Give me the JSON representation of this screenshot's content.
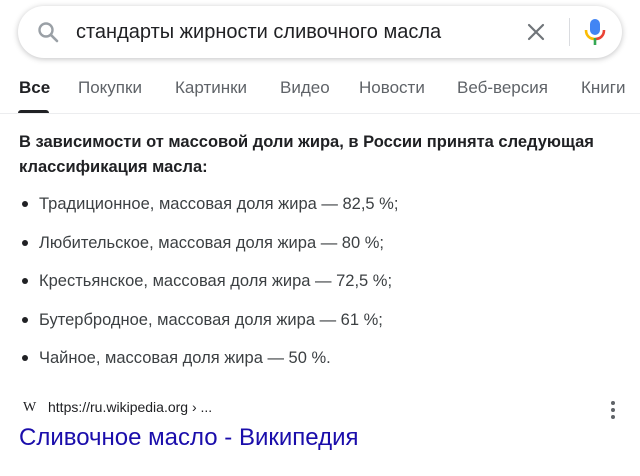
{
  "search": {
    "query": "стандарты жирности сливочного масла",
    "icons": {
      "search": "search-icon",
      "clear": "close-icon",
      "voice": "microphone-icon"
    }
  },
  "tabs": [
    {
      "label": "Все",
      "active": true
    },
    {
      "label": "Покупки",
      "active": false
    },
    {
      "label": "Картинки",
      "active": false
    },
    {
      "label": "Видео",
      "active": false
    },
    {
      "label": "Новости",
      "active": false
    },
    {
      "label": "Веб-версия",
      "active": false
    },
    {
      "label": "Книги",
      "active": false
    }
  ],
  "snippet": {
    "heading": "В зависимости от массовой доли жира, в России принята следующая классификация масла:",
    "items": [
      "Традиционное, массовая доля жира — 82,5 %;",
      "Любительское, массовая доля жира — 80 %;",
      "Крестьянское, массовая доля жира — 72,5 %;",
      "Бутербродное, массовая доля жира — 61 %;",
      "Чайное, массовая доля жира — 50 %."
    ]
  },
  "source": {
    "favicon_text": "W",
    "url": "https://ru.wikipedia.org › ...",
    "title": "Сливочное масло - Википедия"
  },
  "colors": {
    "link": "#1a0dab",
    "text": "#202124",
    "muted": "#5f6368",
    "mic_blue": "#4285f4",
    "mic_red": "#ea4335",
    "mic_yellow": "#fbbc04",
    "mic_green": "#34a853"
  }
}
